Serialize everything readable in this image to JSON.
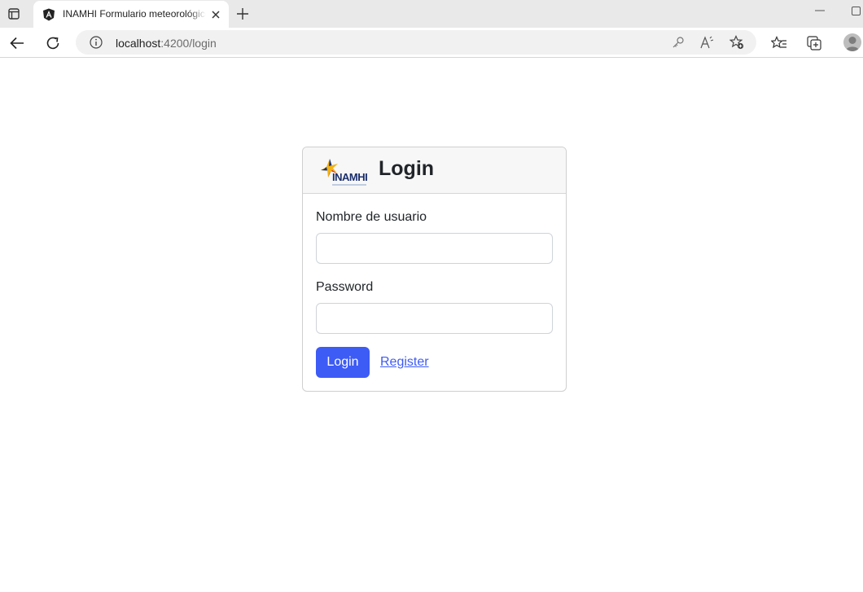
{
  "browser": {
    "tab": {
      "title": "INAMHI Formulario meteorológico",
      "favicon": "angular-icon"
    },
    "address_bar": {
      "host": "localhost",
      "path": ":4200/login"
    },
    "toolbar_icons": [
      "back-icon",
      "reload-icon",
      "info-icon",
      "key-icon",
      "read-aloud-icon",
      "add-favorite-icon",
      "favorites-icon",
      "collections-icon",
      "profile-icon"
    ]
  },
  "login": {
    "logo_text": "INAMHI",
    "title": "Login",
    "username_label": "Nombre de usuario",
    "username_value": "",
    "password_label": "Password",
    "password_value": "",
    "login_button": "Login",
    "register_link": "Register"
  },
  "colors": {
    "primary": "#3d5bf5",
    "header_bg": "#f7f7f7",
    "border": "#cfcfcf"
  }
}
